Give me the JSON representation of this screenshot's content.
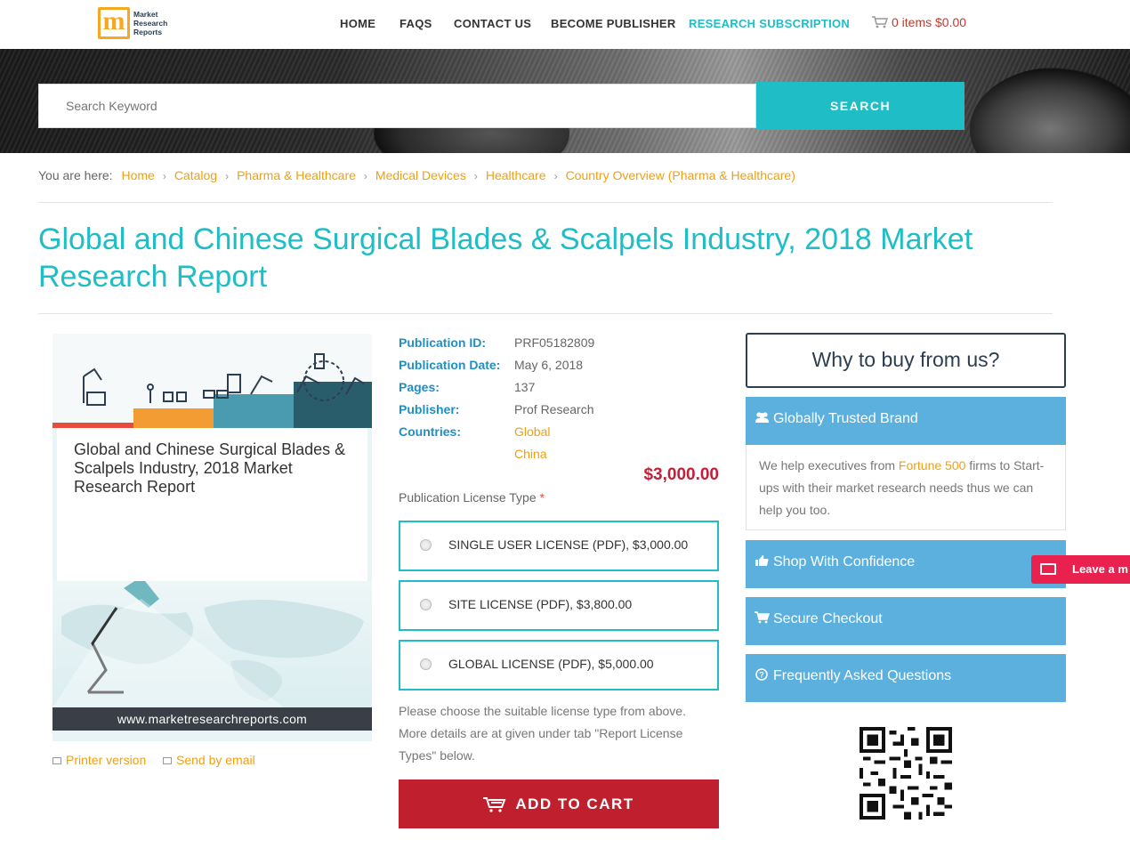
{
  "header": {
    "logo_text": [
      "Market",
      "Research",
      "Reports"
    ],
    "nav": [
      {
        "label": "HOME"
      },
      {
        "label": "FAQS"
      },
      {
        "label": "CONTACT US"
      },
      {
        "label": "BECOME PUBLISHER"
      },
      {
        "label": "RESEARCH SUBSCRIPTION"
      }
    ],
    "cart_label": "0 items $0.00"
  },
  "search": {
    "placeholder": "Search Keyword",
    "button_label": "SEARCH"
  },
  "breadcrumb": {
    "prefix": "You are here:",
    "items": [
      "Home",
      "Catalog",
      "Pharma & Healthcare",
      "Medical Devices",
      "Healthcare",
      "Country Overview (Pharma & Healthcare)"
    ]
  },
  "page_title": "Global and Chinese Surgical Blades & Scalpels Industry, 2018 Market Research Report",
  "product_image": {
    "title": "Global and Chinese Surgical Blades & Scalpels Industry, 2018 Market Research Report",
    "url": "www.marketresearchreports.com"
  },
  "links": {
    "printer": "Printer version",
    "email": "Send by email"
  },
  "details": {
    "publication_id_label": "Publication ID:",
    "publication_id": "PRF05182809",
    "publication_date_label": "Publication Date:",
    "publication_date": "May 6, 2018",
    "pages_label": "Pages:",
    "pages": "137",
    "publisher_label": "Publisher:",
    "publisher": "Prof Research",
    "countries_label": "Countries:",
    "countries": [
      "Global",
      "China"
    ]
  },
  "price": "$3,000.00",
  "license": {
    "label": "Publication License Type",
    "required_mark": "*",
    "options": [
      {
        "label": "SINGLE USER LICENSE (PDF), $3,000.00"
      },
      {
        "label": "SITE LICENSE (PDF), $3,800.00"
      },
      {
        "label": "GLOBAL LICENSE (PDF), $5,000.00"
      }
    ],
    "note": "Please choose the suitable license type from above. More details are at given under tab \"Report License Types\" below."
  },
  "add_to_cart_label": "ADD TO CART",
  "sidebar": {
    "why_title": "Why to buy from us?",
    "panels": [
      {
        "label": "Globally Trusted Brand",
        "icon": "users-icon"
      },
      {
        "label": "Shop With Confidence",
        "icon": "thumbs-up-icon"
      },
      {
        "label": "Secure Checkout",
        "icon": "cart-icon"
      },
      {
        "label": "Frequently Asked Questions",
        "icon": "question-circle-icon"
      }
    ],
    "trusted_body": {
      "before": "We help executives from ",
      "link": "Fortune 500",
      "after": " firms to Start-ups with their market research needs thus we can help you too."
    }
  },
  "leave_message": "Leave a m",
  "colors": {
    "accent": "#1fbdc6",
    "link": "#f0a012",
    "label_blue": "#1f8fc3",
    "price_red": "#c0203a",
    "panel_blue": "#5bb0dd",
    "cart_red": "#c0202e"
  }
}
